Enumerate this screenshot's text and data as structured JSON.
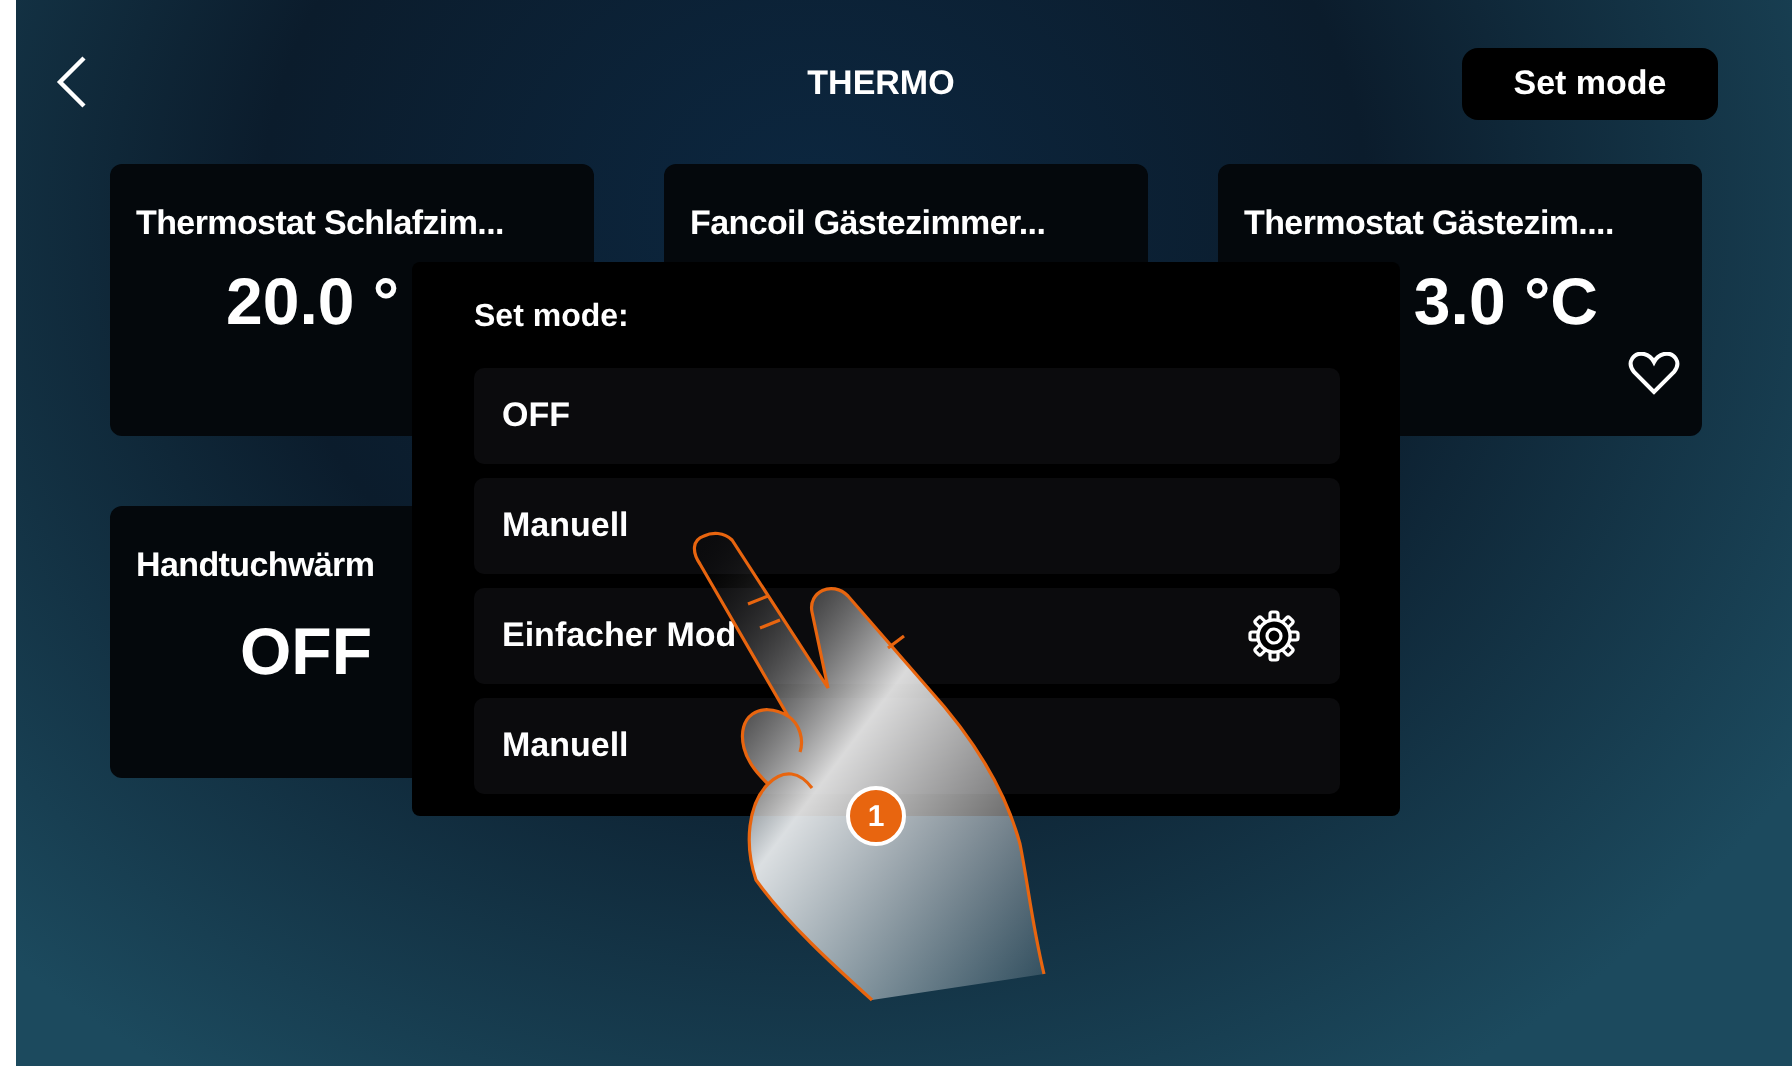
{
  "header": {
    "title": "THERMO",
    "action_button": "Set mode"
  },
  "cards": [
    {
      "title": "Thermostat Schlafzim...",
      "value": "20.0 °",
      "kind": "thermostat",
      "favorite": false
    },
    {
      "title": "Fancoil Gästezimmer...",
      "kind": "fancoil",
      "favorite": false
    },
    {
      "title": "Thermostat Gästezim....",
      "value": "3.0 °C",
      "kind": "thermostat",
      "favorite": true
    },
    {
      "title": "Handtuchwärm",
      "value": "OFF",
      "kind": "towel",
      "favorite": false
    }
  ],
  "popup": {
    "title": "Set mode:",
    "options": [
      {
        "label": "OFF",
        "kind": "plain"
      },
      {
        "label": "Manuell",
        "kind": "plain"
      },
      {
        "label": "Einfacher Mod",
        "kind": "settings"
      },
      {
        "label": "Manuell",
        "kind": "plain"
      }
    ]
  },
  "step_badge": "1"
}
